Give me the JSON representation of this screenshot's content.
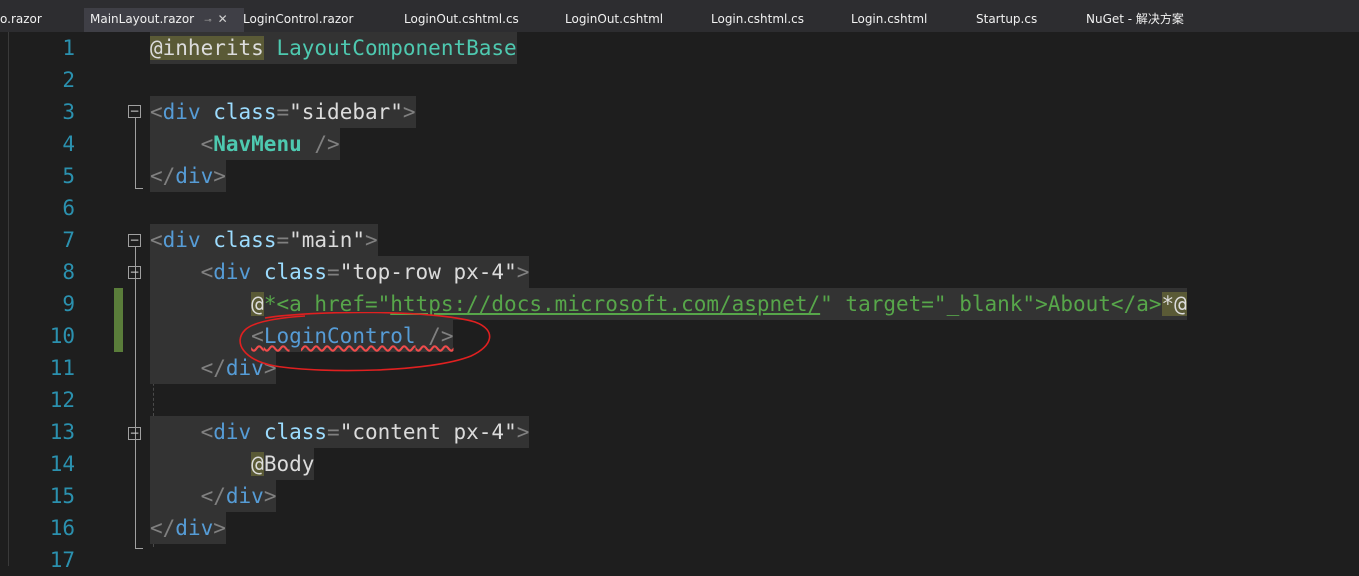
{
  "tabs": [
    {
      "label": "o.razor",
      "active": false
    },
    {
      "label": "MainLayout.razor",
      "active": true,
      "pin_glyph": "⊸",
      "close_glyph": "✕"
    },
    {
      "label": "LoginControl.razor",
      "active": false
    },
    {
      "label": "LoginOut.cshtml.cs",
      "active": false
    },
    {
      "label": "LoginOut.cshtml",
      "active": false
    },
    {
      "label": "Login.cshtml.cs",
      "active": false
    },
    {
      "label": "Login.cshtml",
      "active": false
    },
    {
      "label": "Startup.cs",
      "active": false
    },
    {
      "label": "NuGet - 解决方案",
      "active": false
    }
  ],
  "editor": {
    "line_numbers": [
      "1",
      "2",
      "3",
      "4",
      "5",
      "6",
      "7",
      "8",
      "9",
      "10",
      "11",
      "12",
      "13",
      "14",
      "15",
      "16",
      "17"
    ],
    "code": {
      "l1": {
        "directive": "@inherits",
        "base": "LayoutComponentBase"
      },
      "l3": {
        "open": "<",
        "tag": "div",
        "attr": "class",
        "eq": "=",
        "val": "\"sidebar\"",
        "close": ">"
      },
      "l4": {
        "open": "<",
        "comp": "NavMenu",
        "close": " />"
      },
      "l5": {
        "open": "</",
        "tag": "div",
        "close": ">"
      },
      "l7": {
        "open": "<",
        "tag": "div",
        "attr": "class",
        "eq": "=",
        "val": "\"main\"",
        "close": ">"
      },
      "l8": {
        "open": "<",
        "tag": "div",
        "attr": "class",
        "eq": "=",
        "val": "\"top-row px-4\"",
        "close": ">"
      },
      "l9": {
        "at": "@",
        "star": "*",
        "c1": "<a href=\"",
        "url": "https://docs.microsoft.com/aspnet/",
        "c2": "\" target=\"_blank\">About</a>",
        "end_star": "*",
        "end_at": "@"
      },
      "l10": {
        "open": "<",
        "comp": "LoginControl",
        "close": " />"
      },
      "l11": {
        "open": "</",
        "tag": "div",
        "close": ">"
      },
      "l13": {
        "open": "<",
        "tag": "div",
        "attr": "class",
        "eq": "=",
        "val": "\"content px-4\"",
        "close": ">"
      },
      "l14": {
        "at": "@",
        "body": "Body"
      },
      "l15": {
        "open": "</",
        "tag": "div",
        "close": ">"
      },
      "l16": {
        "open": "</",
        "tag": "div",
        "close": ">"
      }
    },
    "collapse_glyph": "−"
  },
  "colors": {
    "background": "#1e1e1e",
    "line_number": "#2b91af",
    "tag": "#569cd6",
    "component": "#4ec9b0",
    "string": "#d69d85",
    "comment": "#57a64a",
    "annotation": "#e02020"
  }
}
